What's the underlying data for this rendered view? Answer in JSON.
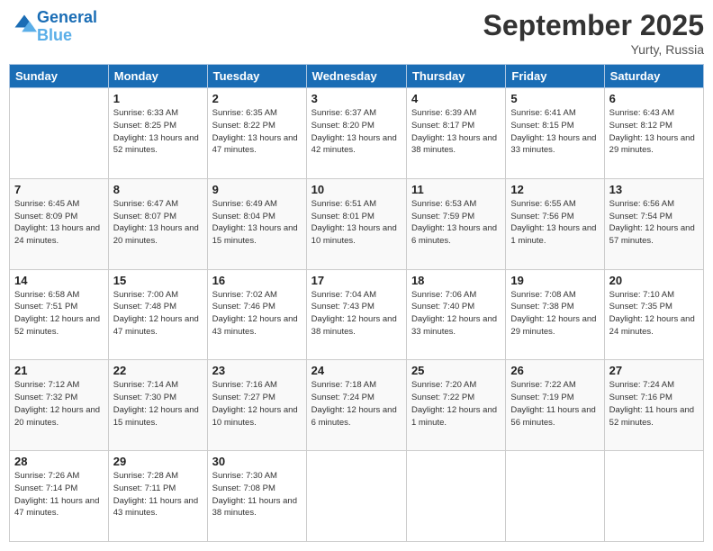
{
  "logo": {
    "line1": "General",
    "line2": "Blue"
  },
  "header": {
    "month": "September 2025",
    "location": "Yurty, Russia"
  },
  "days_of_week": [
    "Sunday",
    "Monday",
    "Tuesday",
    "Wednesday",
    "Thursday",
    "Friday",
    "Saturday"
  ],
  "weeks": [
    [
      {
        "num": "",
        "sunrise": "",
        "sunset": "",
        "daylight": ""
      },
      {
        "num": "1",
        "sunrise": "Sunrise: 6:33 AM",
        "sunset": "Sunset: 8:25 PM",
        "daylight": "Daylight: 13 hours and 52 minutes."
      },
      {
        "num": "2",
        "sunrise": "Sunrise: 6:35 AM",
        "sunset": "Sunset: 8:22 PM",
        "daylight": "Daylight: 13 hours and 47 minutes."
      },
      {
        "num": "3",
        "sunrise": "Sunrise: 6:37 AM",
        "sunset": "Sunset: 8:20 PM",
        "daylight": "Daylight: 13 hours and 42 minutes."
      },
      {
        "num": "4",
        "sunrise": "Sunrise: 6:39 AM",
        "sunset": "Sunset: 8:17 PM",
        "daylight": "Daylight: 13 hours and 38 minutes."
      },
      {
        "num": "5",
        "sunrise": "Sunrise: 6:41 AM",
        "sunset": "Sunset: 8:15 PM",
        "daylight": "Daylight: 13 hours and 33 minutes."
      },
      {
        "num": "6",
        "sunrise": "Sunrise: 6:43 AM",
        "sunset": "Sunset: 8:12 PM",
        "daylight": "Daylight: 13 hours and 29 minutes."
      }
    ],
    [
      {
        "num": "7",
        "sunrise": "Sunrise: 6:45 AM",
        "sunset": "Sunset: 8:09 PM",
        "daylight": "Daylight: 13 hours and 24 minutes."
      },
      {
        "num": "8",
        "sunrise": "Sunrise: 6:47 AM",
        "sunset": "Sunset: 8:07 PM",
        "daylight": "Daylight: 13 hours and 20 minutes."
      },
      {
        "num": "9",
        "sunrise": "Sunrise: 6:49 AM",
        "sunset": "Sunset: 8:04 PM",
        "daylight": "Daylight: 13 hours and 15 minutes."
      },
      {
        "num": "10",
        "sunrise": "Sunrise: 6:51 AM",
        "sunset": "Sunset: 8:01 PM",
        "daylight": "Daylight: 13 hours and 10 minutes."
      },
      {
        "num": "11",
        "sunrise": "Sunrise: 6:53 AM",
        "sunset": "Sunset: 7:59 PM",
        "daylight": "Daylight: 13 hours and 6 minutes."
      },
      {
        "num": "12",
        "sunrise": "Sunrise: 6:55 AM",
        "sunset": "Sunset: 7:56 PM",
        "daylight": "Daylight: 13 hours and 1 minute."
      },
      {
        "num": "13",
        "sunrise": "Sunrise: 6:56 AM",
        "sunset": "Sunset: 7:54 PM",
        "daylight": "Daylight: 12 hours and 57 minutes."
      }
    ],
    [
      {
        "num": "14",
        "sunrise": "Sunrise: 6:58 AM",
        "sunset": "Sunset: 7:51 PM",
        "daylight": "Daylight: 12 hours and 52 minutes."
      },
      {
        "num": "15",
        "sunrise": "Sunrise: 7:00 AM",
        "sunset": "Sunset: 7:48 PM",
        "daylight": "Daylight: 12 hours and 47 minutes."
      },
      {
        "num": "16",
        "sunrise": "Sunrise: 7:02 AM",
        "sunset": "Sunset: 7:46 PM",
        "daylight": "Daylight: 12 hours and 43 minutes."
      },
      {
        "num": "17",
        "sunrise": "Sunrise: 7:04 AM",
        "sunset": "Sunset: 7:43 PM",
        "daylight": "Daylight: 12 hours and 38 minutes."
      },
      {
        "num": "18",
        "sunrise": "Sunrise: 7:06 AM",
        "sunset": "Sunset: 7:40 PM",
        "daylight": "Daylight: 12 hours and 33 minutes."
      },
      {
        "num": "19",
        "sunrise": "Sunrise: 7:08 AM",
        "sunset": "Sunset: 7:38 PM",
        "daylight": "Daylight: 12 hours and 29 minutes."
      },
      {
        "num": "20",
        "sunrise": "Sunrise: 7:10 AM",
        "sunset": "Sunset: 7:35 PM",
        "daylight": "Daylight: 12 hours and 24 minutes."
      }
    ],
    [
      {
        "num": "21",
        "sunrise": "Sunrise: 7:12 AM",
        "sunset": "Sunset: 7:32 PM",
        "daylight": "Daylight: 12 hours and 20 minutes."
      },
      {
        "num": "22",
        "sunrise": "Sunrise: 7:14 AM",
        "sunset": "Sunset: 7:30 PM",
        "daylight": "Daylight: 12 hours and 15 minutes."
      },
      {
        "num": "23",
        "sunrise": "Sunrise: 7:16 AM",
        "sunset": "Sunset: 7:27 PM",
        "daylight": "Daylight: 12 hours and 10 minutes."
      },
      {
        "num": "24",
        "sunrise": "Sunrise: 7:18 AM",
        "sunset": "Sunset: 7:24 PM",
        "daylight": "Daylight: 12 hours and 6 minutes."
      },
      {
        "num": "25",
        "sunrise": "Sunrise: 7:20 AM",
        "sunset": "Sunset: 7:22 PM",
        "daylight": "Daylight: 12 hours and 1 minute."
      },
      {
        "num": "26",
        "sunrise": "Sunrise: 7:22 AM",
        "sunset": "Sunset: 7:19 PM",
        "daylight": "Daylight: 11 hours and 56 minutes."
      },
      {
        "num": "27",
        "sunrise": "Sunrise: 7:24 AM",
        "sunset": "Sunset: 7:16 PM",
        "daylight": "Daylight: 11 hours and 52 minutes."
      }
    ],
    [
      {
        "num": "28",
        "sunrise": "Sunrise: 7:26 AM",
        "sunset": "Sunset: 7:14 PM",
        "daylight": "Daylight: 11 hours and 47 minutes."
      },
      {
        "num": "29",
        "sunrise": "Sunrise: 7:28 AM",
        "sunset": "Sunset: 7:11 PM",
        "daylight": "Daylight: 11 hours and 43 minutes."
      },
      {
        "num": "30",
        "sunrise": "Sunrise: 7:30 AM",
        "sunset": "Sunset: 7:08 PM",
        "daylight": "Daylight: 11 hours and 38 minutes."
      },
      {
        "num": "",
        "sunrise": "",
        "sunset": "",
        "daylight": ""
      },
      {
        "num": "",
        "sunrise": "",
        "sunset": "",
        "daylight": ""
      },
      {
        "num": "",
        "sunrise": "",
        "sunset": "",
        "daylight": ""
      },
      {
        "num": "",
        "sunrise": "",
        "sunset": "",
        "daylight": ""
      }
    ]
  ]
}
